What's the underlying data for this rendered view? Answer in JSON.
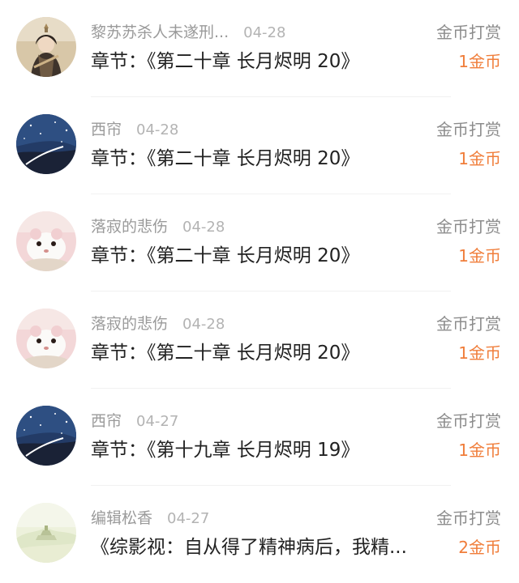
{
  "rows": [
    {
      "avatar": "character-avatar",
      "name": "黎苏苏杀人未遂刑...",
      "date": "04-28",
      "type": "金币打赏",
      "chapter": "章节：《第二十章 长月烬明 20》",
      "amount": "1金币"
    },
    {
      "avatar": "night-sky-avatar",
      "name": "西帘",
      "date": "04-28",
      "type": "金币打赏",
      "chapter": "章节：《第二十章 长月烬明 20》",
      "amount": "1金币"
    },
    {
      "avatar": "hamster-avatar",
      "name": "落寂的悲伤",
      "date": "04-28",
      "type": "金币打赏",
      "chapter": "章节：《第二十章 长月烬明 20》",
      "amount": "1金币"
    },
    {
      "avatar": "hamster-avatar",
      "name": "落寂的悲伤",
      "date": "04-28",
      "type": "金币打赏",
      "chapter": "章节：《第二十章 长月烬明 20》",
      "amount": "1金币"
    },
    {
      "avatar": "night-sky-avatar",
      "name": "西帘",
      "date": "04-27",
      "type": "金币打赏",
      "chapter": "章节：《第十九章 长月烬明 19》",
      "amount": "1金币"
    },
    {
      "avatar": "misty-landscape-avatar",
      "name": "编辑松香",
      "date": "04-27",
      "type": "金币打赏",
      "chapter": "《综影视：自从得了精神病后，我精...",
      "amount": "2金币"
    }
  ],
  "colors": {
    "name": "#9a9a9a",
    "date": "#b3b3b3",
    "chapter": "#222222",
    "type": "#8c8c8c",
    "amount": "#f07d3a",
    "divider": "#f1f1f1"
  }
}
